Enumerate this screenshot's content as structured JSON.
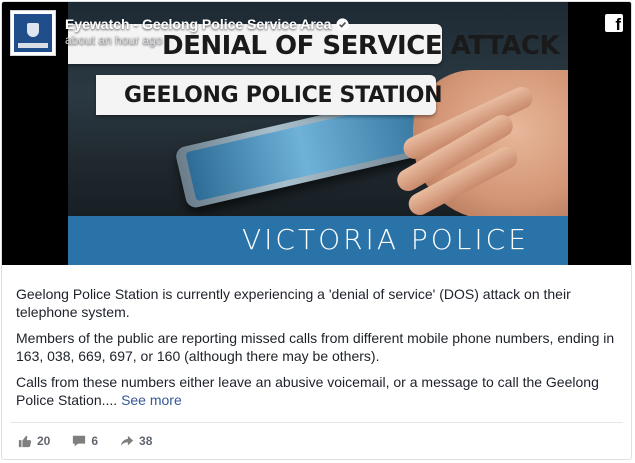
{
  "post": {
    "page_name": "Eyewatch - Geelong Police Service Area",
    "timestamp": "about an hour ago",
    "platform_icon": "facebook-icon"
  },
  "image": {
    "banner_top": "DENIAL OF SERVICE ATTACK",
    "banner_middle": "GEELONG POLICE STATION",
    "footer_text": "VICTORIA POLICE",
    "accent_color": "#2a73a8"
  },
  "body": {
    "paragraph_1": "Geelong Police Station is currently experiencing a 'denial of service' (DOS) attack on their telephone system.",
    "paragraph_2": "Members of the public are reporting missed calls from different mobile phone numbers, ending in 163, 038, 669, 697, or 160 (although there may be others).",
    "paragraph_3": "Calls from these numbers either leave an abusive voicemail, or a message to call the Geelong Police Station....",
    "see_more": "See more"
  },
  "actions": {
    "likes": "20",
    "comments": "6",
    "shares": "38"
  },
  "colors": {
    "link": "#365899",
    "text": "#1d2129",
    "muted": "#616770"
  }
}
